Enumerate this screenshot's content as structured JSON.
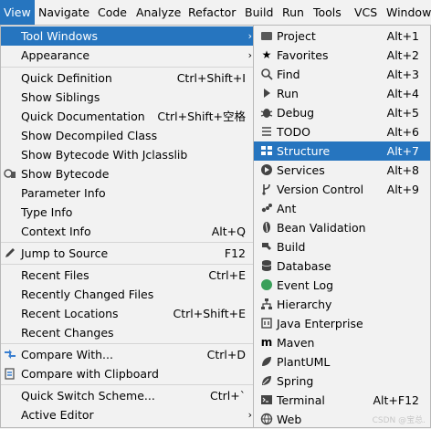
{
  "menubar": {
    "items": [
      "View",
      "Navigate",
      "Code",
      "Analyze",
      "Refactor",
      "Build",
      "Run",
      "Tools",
      "VCS",
      "Window"
    ]
  },
  "view_menu": {
    "items": [
      {
        "label": "Tool Windows",
        "shortcut": "",
        "submenu": true
      },
      {
        "label": "Appearance",
        "shortcut": "",
        "submenu": true
      },
      {
        "label": "Quick Definition",
        "shortcut": "Ctrl+Shift+I"
      },
      {
        "label": "Show Siblings",
        "shortcut": ""
      },
      {
        "label": "Quick Documentation",
        "shortcut": "Ctrl+Shift+空格"
      },
      {
        "label": "Show Decompiled Class",
        "shortcut": ""
      },
      {
        "label": "Show Bytecode With Jclasslib",
        "shortcut": ""
      },
      {
        "label": "Show Bytecode",
        "shortcut": ""
      },
      {
        "label": "Parameter Info",
        "shortcut": ""
      },
      {
        "label": "Type Info",
        "shortcut": ""
      },
      {
        "label": "Context Info",
        "shortcut": "Alt+Q"
      },
      {
        "label": "Jump to Source",
        "shortcut": "F12"
      },
      {
        "label": "Recent Files",
        "shortcut": "Ctrl+E"
      },
      {
        "label": "Recently Changed Files",
        "shortcut": ""
      },
      {
        "label": "Recent Locations",
        "shortcut": "Ctrl+Shift+E"
      },
      {
        "label": "Recent Changes",
        "shortcut": ""
      },
      {
        "label": "Compare With...",
        "shortcut": "Ctrl+D"
      },
      {
        "label": "Compare with Clipboard",
        "shortcut": ""
      },
      {
        "label": "Quick Switch Scheme...",
        "shortcut": "Ctrl+`"
      },
      {
        "label": "Active Editor",
        "shortcut": "",
        "submenu": true
      }
    ]
  },
  "tool_windows_menu": {
    "items": [
      {
        "label": "Project",
        "shortcut": "Alt+1",
        "icon": "folder-icon"
      },
      {
        "label": "Favorites",
        "shortcut": "Alt+2",
        "icon": "star-icon"
      },
      {
        "label": "Find",
        "shortcut": "Alt+3",
        "icon": "search-icon"
      },
      {
        "label": "Run",
        "shortcut": "Alt+4",
        "icon": "run-icon"
      },
      {
        "label": "Debug",
        "shortcut": "Alt+5",
        "icon": "debug-icon"
      },
      {
        "label": "TODO",
        "shortcut": "Alt+6",
        "icon": "todo-icon"
      },
      {
        "label": "Structure",
        "shortcut": "Alt+7",
        "icon": "structure-icon"
      },
      {
        "label": "Services",
        "shortcut": "Alt+8",
        "icon": "services-icon"
      },
      {
        "label": "Version Control",
        "shortcut": "Alt+9",
        "icon": "version-control-icon"
      },
      {
        "label": "Ant",
        "shortcut": "",
        "icon": "ant-icon"
      },
      {
        "label": "Bean Validation",
        "shortcut": "",
        "icon": "bean-validation-icon"
      },
      {
        "label": "Build",
        "shortcut": "",
        "icon": "build-icon"
      },
      {
        "label": "Database",
        "shortcut": "",
        "icon": "database-icon"
      },
      {
        "label": "Event Log",
        "shortcut": "",
        "icon": "event-log-icon"
      },
      {
        "label": "Hierarchy",
        "shortcut": "",
        "icon": "hierarchy-icon"
      },
      {
        "label": "Java Enterprise",
        "shortcut": "",
        "icon": "java-enterprise-icon"
      },
      {
        "label": "Maven",
        "shortcut": "",
        "icon": "maven-icon"
      },
      {
        "label": "PlantUML",
        "shortcut": "",
        "icon": "plantuml-icon"
      },
      {
        "label": "Spring",
        "shortcut": "",
        "icon": "spring-icon"
      },
      {
        "label": "Terminal",
        "shortcut": "Alt+F12",
        "icon": "terminal-icon"
      },
      {
        "label": "Web",
        "shortcut": "",
        "icon": "web-icon"
      }
    ]
  },
  "watermark": "CSDN @宝总.",
  "colors": {
    "selection": "#2675bf",
    "menu_bg": "#f2f2f2"
  }
}
